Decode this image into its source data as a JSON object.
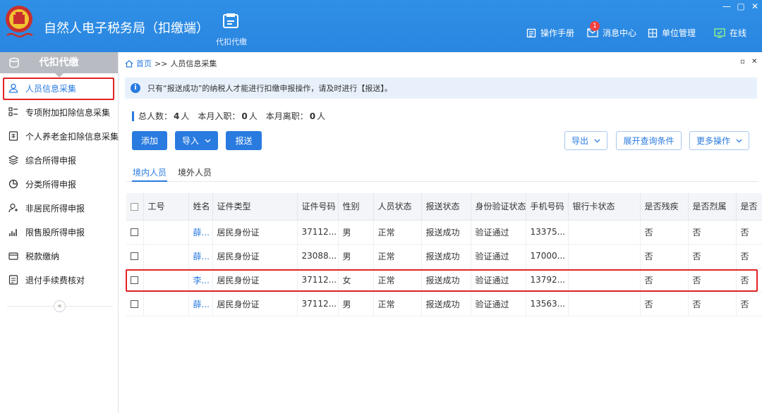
{
  "app": {
    "title": "自然人电子税务局（扣缴端）",
    "nav_tile": "代扣代缴",
    "menu": {
      "manual": "操作手册",
      "messages": "消息中心",
      "unit": "单位管理",
      "online": "在线"
    },
    "message_count": "1",
    "window_controls": [
      "—",
      "▢",
      "✕"
    ]
  },
  "sidebar": {
    "header": "代扣代缴",
    "items": [
      {
        "label": "人员信息采集",
        "icon": "person-icon"
      },
      {
        "label": "专项附加扣除信息采集",
        "icon": "grid-list-icon"
      },
      {
        "label": "个人养老金扣除信息采集",
        "icon": "pension-doc-icon"
      },
      {
        "label": "综合所得申报",
        "icon": "layers-icon"
      },
      {
        "label": "分类所得申报",
        "icon": "pie-chart-icon"
      },
      {
        "label": "非居民所得申报",
        "icon": "non-resident-icon"
      },
      {
        "label": "限售股所得申报",
        "icon": "bar-chart-icon"
      },
      {
        "label": "税款缴纳",
        "icon": "wallet-icon"
      },
      {
        "label": "退付手续费核对",
        "icon": "checklist-icon"
      }
    ],
    "collapse_symbol": "«"
  },
  "breadcrumb": {
    "home": "首页",
    "sep": ">>",
    "current": "人员信息采集"
  },
  "notice": {
    "icon_text": "i",
    "text": "只有“报送成功”的纳税人才能进行扣缴申报操作，请及时进行【报送】。"
  },
  "stats": {
    "total_label": "总人数：",
    "total": "4",
    "unit": "人",
    "hired_label": "本月入职：",
    "hired": "0",
    "left_label": "本月离职：",
    "left": "0"
  },
  "toolbar": {
    "add": "添加",
    "import": "导入",
    "submit": "报送",
    "export": "导出",
    "expand_query": "展开查询条件",
    "more": "更多操作"
  },
  "tabs": [
    "境内人员",
    "境外人员"
  ],
  "table": {
    "headers": [
      "",
      "工号",
      "姓名",
      "证件类型",
      "证件号码",
      "性别",
      "人员状态",
      "报送状态",
      "身份验证状态",
      "手机号码",
      "银行卡状态",
      "是否残疾",
      "是否烈属",
      "是否"
    ],
    "rows": [
      [
        "",
        "",
        "薛...",
        "居民身份证",
        "37112...",
        "男",
        "正常",
        "报送成功",
        "验证通过",
        "13375...",
        "",
        "否",
        "否",
        "否"
      ],
      [
        "",
        "",
        "薛...",
        "居民身份证",
        "23088...",
        "男",
        "正常",
        "报送成功",
        "验证通过",
        "17000...",
        "",
        "否",
        "否",
        "否"
      ],
      [
        "",
        "",
        "李...",
        "居民身份证",
        "37112...",
        "女",
        "正常",
        "报送成功",
        "验证通过",
        "13792...",
        "",
        "否",
        "否",
        "否"
      ],
      [
        "",
        "",
        "薛...",
        "居民身份证",
        "37112...",
        "男",
        "正常",
        "报送成功",
        "验证通过",
        "13563...",
        "",
        "否",
        "否",
        "否"
      ]
    ]
  },
  "colors": {
    "primary": "#2a7be0",
    "header_bg": "#2f8fe6",
    "highlight": "#e32222"
  }
}
